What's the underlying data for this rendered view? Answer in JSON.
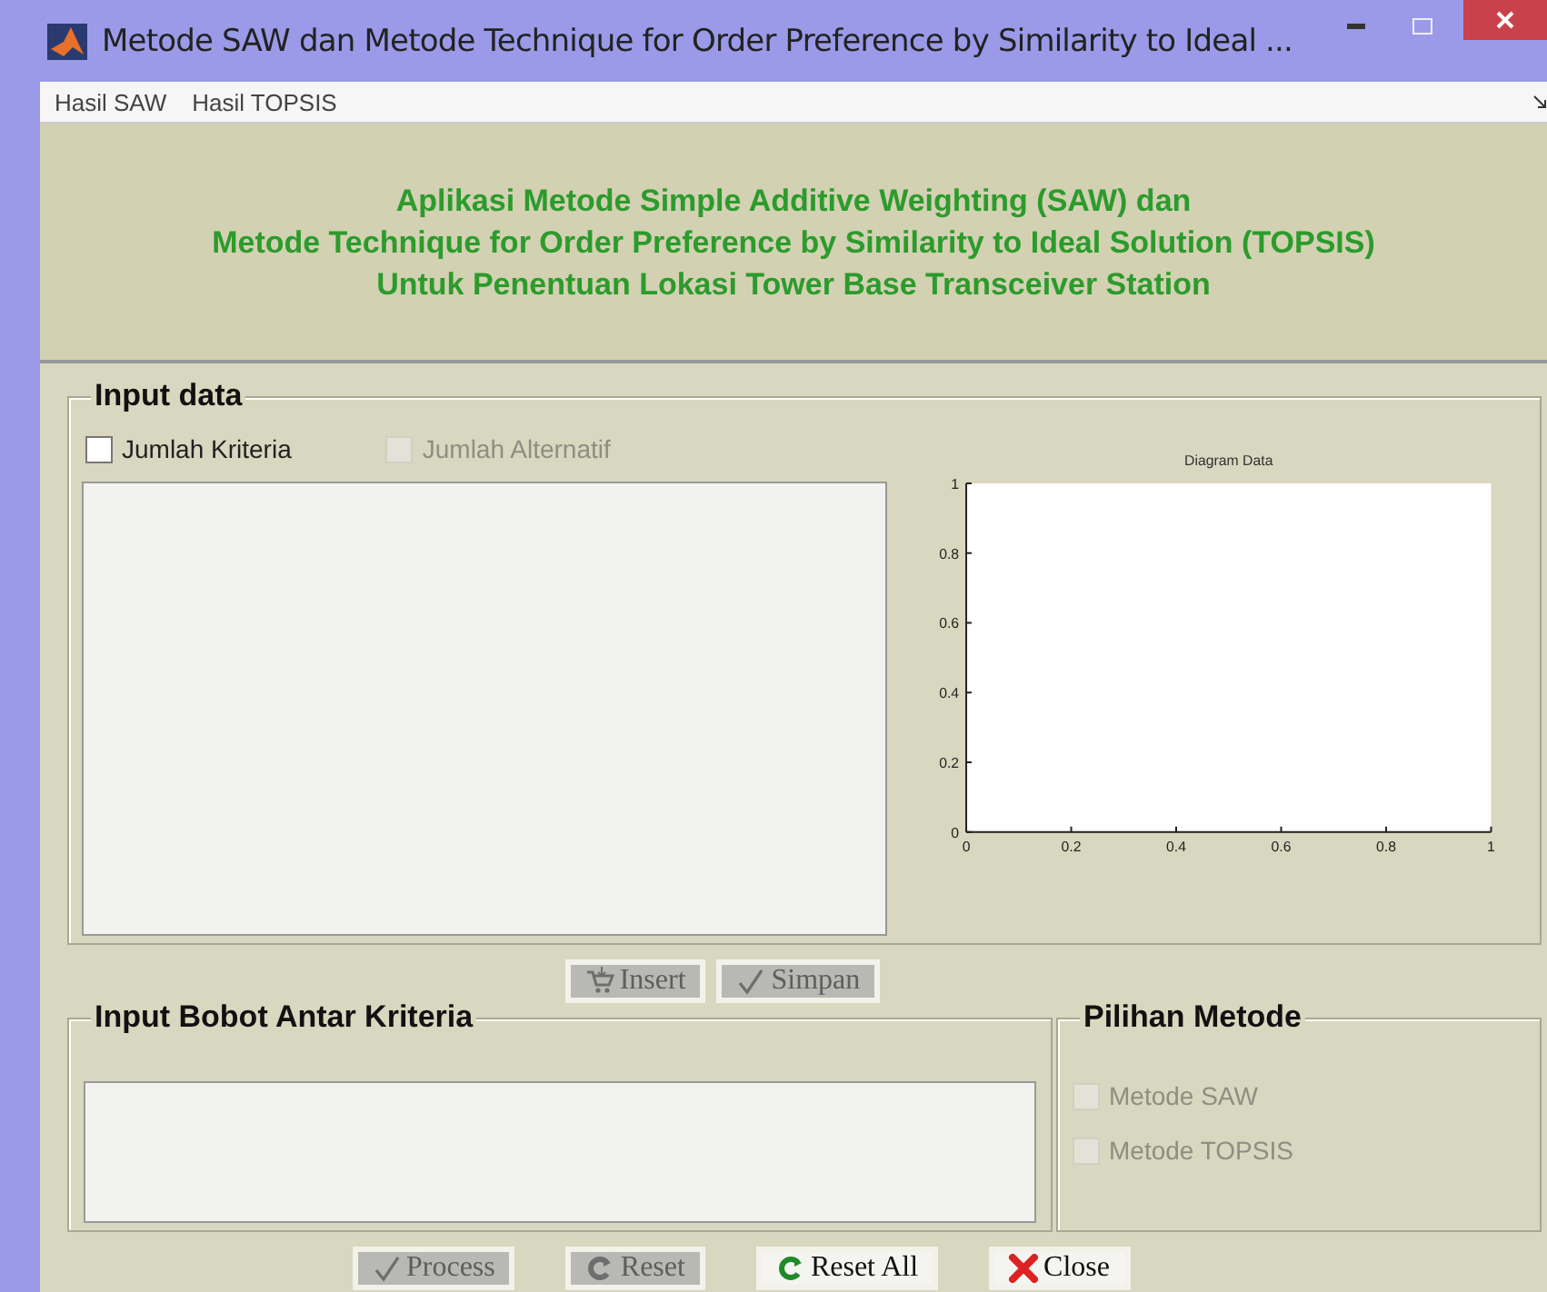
{
  "window": {
    "title": "Metode SAW dan Metode Technique for Order Preference by Similarity to Ideal ..."
  },
  "menu": [
    {
      "label": "Hasil SAW"
    },
    {
      "label": "Hasil TOPSIS"
    }
  ],
  "header": {
    "lines": [
      "Aplikasi Metode Simple Additive Weighting (SAW) dan",
      "Metode Technique for Order Preference by Similarity to Ideal Solution (TOPSIS)",
      "Untuk Penentuan Lokasi Tower Base Transceiver Station"
    ]
  },
  "input_data": {
    "title": "Input data",
    "checkboxes": [
      {
        "label": "Jumlah Kriteria",
        "checked": false,
        "disabled": false
      },
      {
        "label": "Jumlah Alternatif",
        "checked": false,
        "disabled": true
      }
    ],
    "chart_data": {
      "type": "line",
      "title": "Diagram Data",
      "xlim": [
        0,
        1
      ],
      "ylim": [
        0,
        1
      ],
      "xticks": [
        0,
        0.2,
        0.4,
        0.6,
        0.8,
        1
      ],
      "yticks": [
        0,
        0.2,
        0.4,
        0.6,
        0.8,
        1
      ]
    }
  },
  "data_buttons": [
    {
      "label": "Insert",
      "disabled": true
    },
    {
      "label": "Simpan",
      "disabled": true
    }
  ],
  "bobot": {
    "title": "Input Bobot Antar Kriteria"
  },
  "pilihan": {
    "title": "Pilihan Metode",
    "checkboxes": [
      {
        "label": "Metode SAW",
        "checked": false,
        "disabled": true
      },
      {
        "label": "Metode TOPSIS",
        "checked": false,
        "disabled": true
      }
    ]
  },
  "action_buttons": [
    {
      "label": "Process",
      "disabled": true
    },
    {
      "label": "Reset",
      "disabled": true
    },
    {
      "label": "Reset All",
      "disabled": false
    },
    {
      "label": "Close",
      "disabled": false
    }
  ]
}
